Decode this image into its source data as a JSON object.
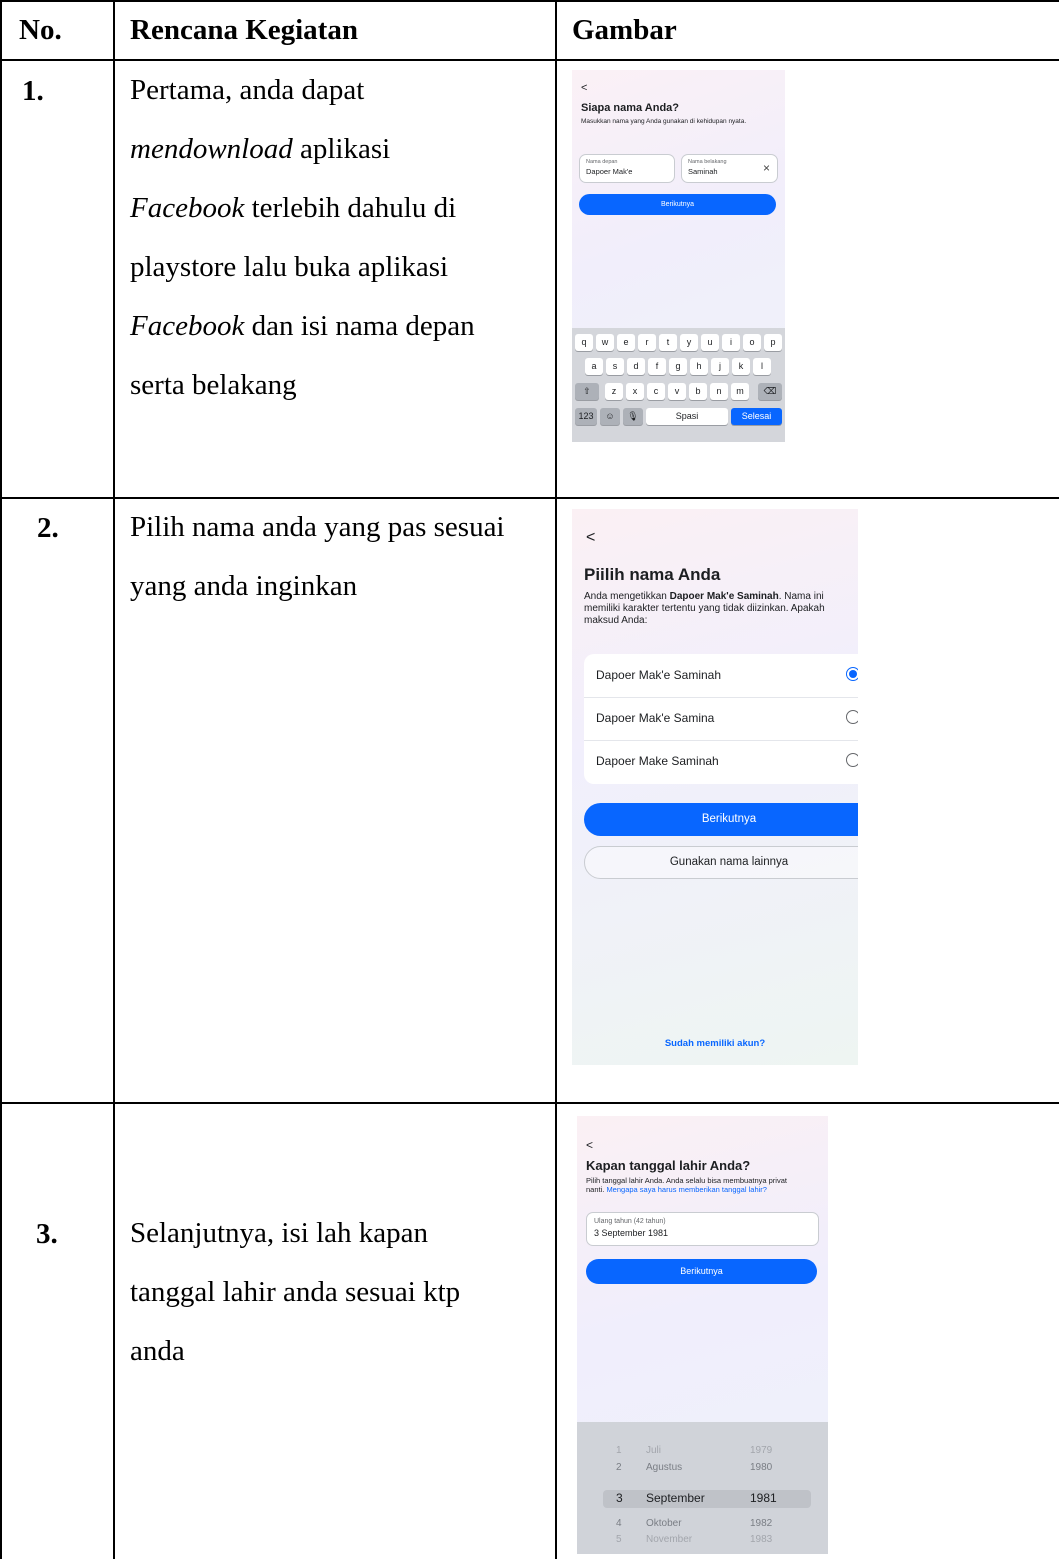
{
  "headers": {
    "no": "No.",
    "rencana": "Rencana Kegiatan",
    "gambar": "Gambar"
  },
  "rows": [
    {
      "no": "1.",
      "lines": [
        {
          "parts": [
            {
              "t": "Pertama, anda dapat",
              "i": false
            }
          ]
        },
        {
          "parts": [
            {
              "t": "mendownload",
              "i": true
            },
            {
              "t": " aplikasi",
              "i": false
            }
          ]
        },
        {
          "parts": [
            {
              "t": "Facebook",
              "i": true
            },
            {
              "t": " terlebih dahulu di",
              "i": false
            }
          ]
        },
        {
          "parts": [
            {
              "t": "playstore lalu buka aplikasi",
              "i": false
            }
          ]
        },
        {
          "parts": [
            {
              "t": "Facebook",
              "i": true
            },
            {
              "t": " dan isi nama depan",
              "i": false
            }
          ]
        },
        {
          "parts": [
            {
              "t": "serta belakang",
              "i": false
            }
          ]
        }
      ]
    },
    {
      "no": "2.",
      "lines": [
        {
          "parts": [
            {
              "t": "Pilih nama anda yang pas sesuai",
              "i": false
            }
          ]
        },
        {
          "parts": [
            {
              "t": "yang anda inginkan",
              "i": false
            }
          ]
        }
      ]
    },
    {
      "no": "3.",
      "lines": [
        {
          "parts": [
            {
              "t": "Selanjutnya, isi lah kapan",
              "i": false
            }
          ]
        },
        {
          "parts": [
            {
              "t": "tanggal lahir anda sesuai ktp",
              "i": false
            }
          ]
        },
        {
          "parts": [
            {
              "t": "anda",
              "i": false
            }
          ]
        }
      ]
    }
  ],
  "screen1": {
    "back": "<",
    "title": "Siapa nama Anda?",
    "desc": "Masukkan nama yang Anda gunakan di kehidupan nyata.",
    "first_label": "Nama depan",
    "first_value": "Dapoer Mak'e",
    "last_label": "Nama belakang",
    "last_value": "Saminah",
    "clear": "×",
    "button": "Berikutnya",
    "keyboard": {
      "row1": [
        "q",
        "w",
        "e",
        "r",
        "t",
        "y",
        "u",
        "i",
        "o",
        "p"
      ],
      "row2": [
        "a",
        "s",
        "d",
        "f",
        "g",
        "h",
        "j",
        "k",
        "l"
      ],
      "row3": [
        "z",
        "x",
        "c",
        "v",
        "b",
        "n",
        "m"
      ],
      "shift": "⇧",
      "backspace": "⌫",
      "numbers": "123",
      "emoji": "☺",
      "mic": "🎙",
      "space": "Spasi",
      "done": "Selesai"
    }
  },
  "screen2": {
    "back": "<",
    "title": "Piilih nama Anda",
    "desc_pre": "Anda mengetikkan ",
    "desc_bold": "Dapoer Mak'e Saminah",
    "desc_post": ". Nama ini memiliki karakter tertentu yang tidak diizinkan. Apakah maksud Anda:",
    "options": [
      {
        "label": "Dapoer Mak'e Saminah",
        "selected": true
      },
      {
        "label": "Dapoer Mak'e Samina",
        "selected": false
      },
      {
        "label": "Dapoer Make Saminah",
        "selected": false
      }
    ],
    "button": "Berikutnya",
    "alt_button": "Gunakan nama lainnya",
    "link": "Sudah memiliki akun?"
  },
  "screen3": {
    "back": "<",
    "title": "Kapan tanggal lahir Anda?",
    "desc_pre": "Pilih tanggal lahir Anda. Anda selalu bisa membuatnya privat nanti. ",
    "desc_link": "Mengapa saya harus memberikan tanggal lahir?",
    "field_label": "Ulang tahun (42 tahun)",
    "field_value": "3 September 1981",
    "button": "Berikutnya",
    "picker": [
      {
        "day": "1",
        "month": "Juli",
        "year": "1979"
      },
      {
        "day": "2",
        "month": "Agustus",
        "year": "1980"
      },
      {
        "day": "3",
        "month": "September",
        "year": "1981"
      },
      {
        "day": "4",
        "month": "Oktober",
        "year": "1982"
      },
      {
        "day": "5",
        "month": "November",
        "year": "1983"
      }
    ]
  }
}
